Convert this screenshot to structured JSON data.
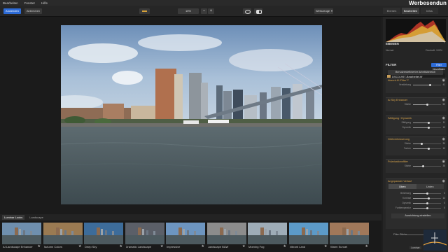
{
  "menubar": {
    "items": [
      "Bearbeiten",
      "Fenster",
      "Hilfe"
    ],
    "brand": "Werbesendun"
  },
  "toolbar": {
    "apply_label": "Anwenden",
    "cancel_label": "Abbrechen",
    "zoom_value": "15%",
    "zoom_minus": "−",
    "zoom_plus": "+",
    "workspace": "Werkzeuge"
  },
  "mode_tabs": [
    "Ebenen",
    "Bearbeiten",
    "Infos"
  ],
  "looks": {
    "tabs": [
      "Luminar Looks",
      "Landscape"
    ],
    "items": [
      {
        "label": "AI Landscape Enhancer",
        "tone": "#6f8fae"
      },
      {
        "label": "Autumn Colors",
        "tone": "#9a7a52"
      },
      {
        "label": "Deep Sky",
        "tone": "#3d6c9a"
      },
      {
        "label": "Dramatic Landscape",
        "tone": "#5b5f68"
      },
      {
        "label": "Impressive",
        "tone": "#6d95c0"
      },
      {
        "label": "Landscape B&W",
        "tone": "#8c8c8c"
      },
      {
        "label": "Morning Fog",
        "tone": "#9eacb7"
      },
      {
        "label": "Vibrant Land",
        "tone": "#5c9ac8"
      },
      {
        "label": "Warm Sunset",
        "tone": "#a0785a"
      }
    ]
  },
  "panel": {
    "histogram_info": "",
    "layers_title": "EBENEN",
    "layer_mode": "Normal",
    "layer_opacity": "Deckraft: 100%",
    "layer_file": "DSC01997-Bearbeitet.tif",
    "filter_title": "FILTER",
    "filter_add": "Filter hinzufügen",
    "custom_workspace": "Benutzerdefinierter Arbeitsbereich",
    "filters": [
      {
        "title": "Akzent-KI-Filter™",
        "sliders": [
          {
            "label": "Verstärkung",
            "value": "41",
            "pos": 0.61
          }
        ]
      },
      {
        "title": "AI Sky Enhancer",
        "sliders": [
          {
            "label": "Stärke",
            "value": "50",
            "pos": 0.5
          }
        ]
      },
      {
        "title": "Sättigung / Dynamik",
        "sliders": [
          {
            "label": "Sättigung",
            "value": "11",
            "pos": 0.56
          },
          {
            "label": "Dynamik",
            "value": "10",
            "pos": 0.55
          }
        ]
      },
      {
        "title": "Glühverbesserung",
        "sliders": [
          {
            "label": "Stärke",
            "value": "30",
            "pos": 0.3
          },
          {
            "label": "Farben",
            "value": "10",
            "pos": 0.55
          }
        ]
      },
      {
        "title": "Polarisationsfilter",
        "sliders": [
          {
            "label": "Stärke",
            "value": "35",
            "pos": 0.35
          }
        ]
      },
      {
        "title": "Angepasster Verlauf",
        "sliders": [
          {
            "label": "Belichtung",
            "value": "0",
            "pos": 0.5
          },
          {
            "label": "Kontrast",
            "value": "14",
            "pos": 0.57
          },
          {
            "label": "Dynamik",
            "value": "0",
            "pos": 0.5
          },
          {
            "label": "Farbtemperatur",
            "value": "0",
            "pos": 0.5
          }
        ]
      }
    ],
    "gradient_tabs": [
      "Oben",
      "Unten"
    ],
    "align_button": "Ausrichtung einstellen",
    "filter_strength": "Filter-Stärke",
    "eye_label": "Luminar"
  }
}
